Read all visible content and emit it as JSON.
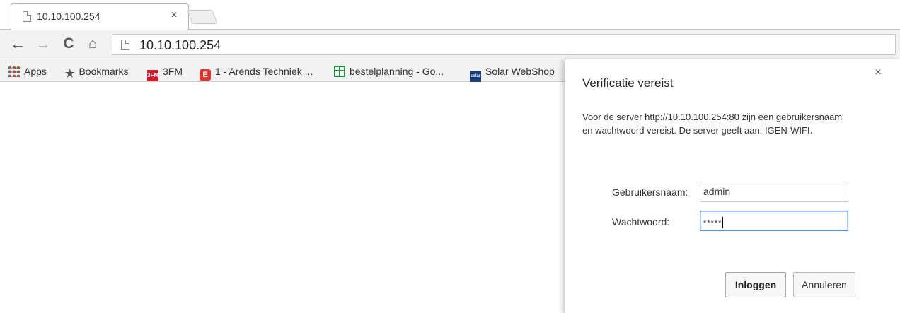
{
  "browser": {
    "tab_title": "10.10.100.254",
    "tab_close": "×",
    "url": "10.10.100.254"
  },
  "icons": {
    "back": "arrow-left-icon",
    "forward": "arrow-right-icon",
    "reload": "reload-icon",
    "home": "home-icon"
  },
  "bookmarks": {
    "items": [
      {
        "label": "Apps",
        "icon": "apps-grid-icon"
      },
      {
        "label": "Bookmarks",
        "icon": "star-icon"
      },
      {
        "label": "3FM",
        "icon": "3fm-icon",
        "icon_text": "3FM"
      },
      {
        "label": "1 - Arends Techniek ...",
        "icon": "e-icon",
        "icon_text": "E"
      },
      {
        "label": "bestelplanning - Go...",
        "icon": "sheets-icon"
      },
      {
        "label": "Solar WebShop",
        "icon": "solar-icon",
        "icon_text": "solar"
      }
    ]
  },
  "dialog": {
    "title": "Verificatie vereist",
    "close": "×",
    "message": "Voor de server http://10.10.100.254:80 zijn een gebruikersnaam en wachtwoord vereist. De server geeft aan: IGEN-WIFI.",
    "username_label": "Gebruikersnaam:",
    "username_value": "admin",
    "password_label": "Wachtwoord:",
    "password_value": "*****",
    "login_label": "Inloggen",
    "cancel_label": "Annuleren"
  },
  "colors": {
    "focus_border": "#4d90fe",
    "toolbar_bg": "#f2f2f2"
  }
}
